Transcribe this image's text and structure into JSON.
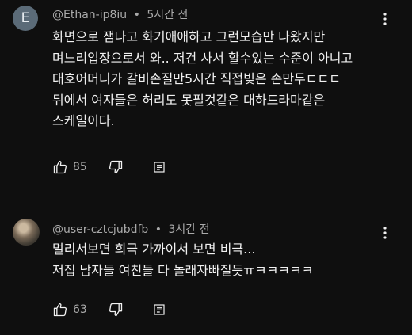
{
  "comments": [
    {
      "avatar_letter": "E",
      "author": "@Ethan-ip8iu",
      "separator": "•",
      "time": "5시간 전",
      "lines": [
        "화면으로 잼나고 화기애애하고 그런모습만 나왔지만",
        "며느리입장으로서 와.. 저건 사서 할수있는 수준이 아니고",
        "대호어머니가 갈비손질만5시간 직접빚은 손만두ㄷㄷㄷ",
        "뒤에서 여자들은 허리도 못필것같은 대하드라마같은",
        "스케일이다."
      ],
      "likes": "85"
    },
    {
      "author": "@user-cztcjubdfb",
      "separator": "•",
      "time": "3시간 전",
      "lines": [
        "멀리서보면 희극 가까이서 보면 비극...",
        "저집 남자들 여친들 다 놀래자빠질듯ㅠㅋㅋㅋㅋㅋ"
      ],
      "likes": "63"
    }
  ],
  "icons": {
    "like": "thumb-up-icon",
    "dislike": "thumb-down-icon",
    "reply": "reply-icon",
    "more": "more-vertical-icon"
  },
  "colors": {
    "background": "#0f0f0f",
    "text_primary": "#f1f1f1",
    "text_secondary": "#aaaaaa",
    "avatar_e": "#5b6b78"
  }
}
